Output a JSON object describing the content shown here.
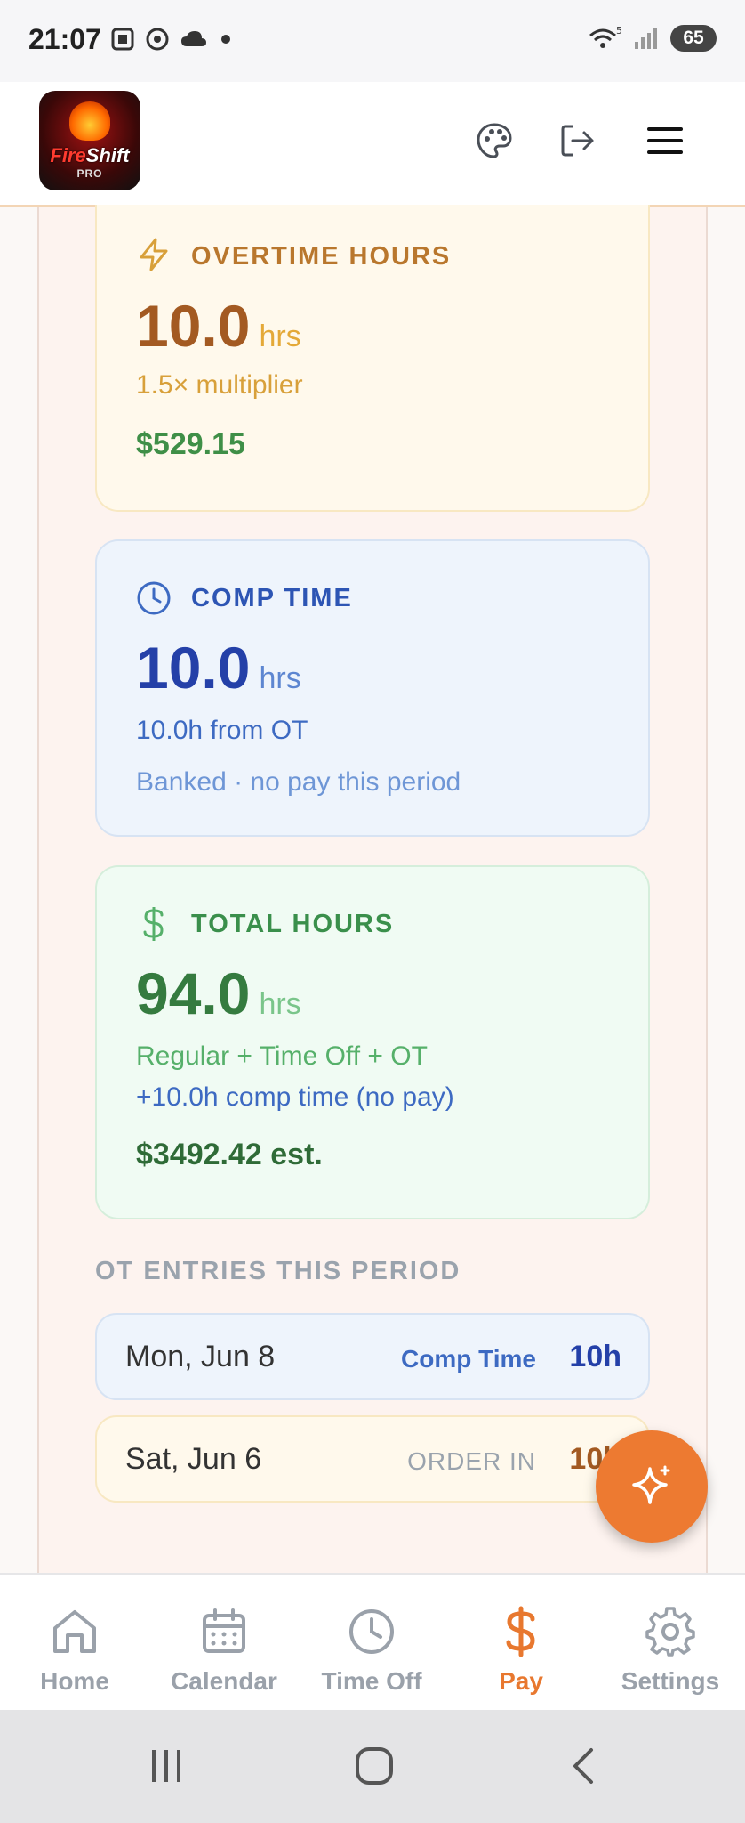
{
  "status_bar": {
    "time": "21:07",
    "battery": "65",
    "wifi_label": "5"
  },
  "header": {
    "logo_text_1": "Fire",
    "logo_text_2": "Shift",
    "logo_sub": "PRO"
  },
  "cards": {
    "overtime": {
      "label": "OVERTIME HOURS",
      "value": "10.0",
      "unit": "hrs",
      "multiplier": "1.5× multiplier",
      "pay": "$529.15"
    },
    "comp_time": {
      "label": "COMP TIME",
      "value": "10.0",
      "unit": "hrs",
      "source": "10.0h from OT",
      "note": "Banked · no pay this period"
    },
    "total": {
      "label": "TOTAL HOURS",
      "value": "94.0",
      "unit": "hrs",
      "breakdown": "Regular + Time Off + OT",
      "comp_note": "+10.0h comp time (no pay)",
      "pay": "$3492.42 est."
    }
  },
  "ot_entries": {
    "title": "OT ENTRIES THIS PERIOD",
    "items": [
      {
        "date": "Mon, Jun 8",
        "type": "Comp Time",
        "hours": "10h"
      },
      {
        "date": "Sat, Jun 6",
        "type": "ORDER IN",
        "hours": "10h"
      }
    ]
  },
  "bottom_nav": {
    "items": [
      {
        "label": "Home"
      },
      {
        "label": "Calendar"
      },
      {
        "label": "Time Off"
      },
      {
        "label": "Pay"
      },
      {
        "label": "Settings"
      }
    ],
    "active": "Pay"
  },
  "colors": {
    "accent": "#e8782f",
    "fab": "#ed7a31"
  }
}
